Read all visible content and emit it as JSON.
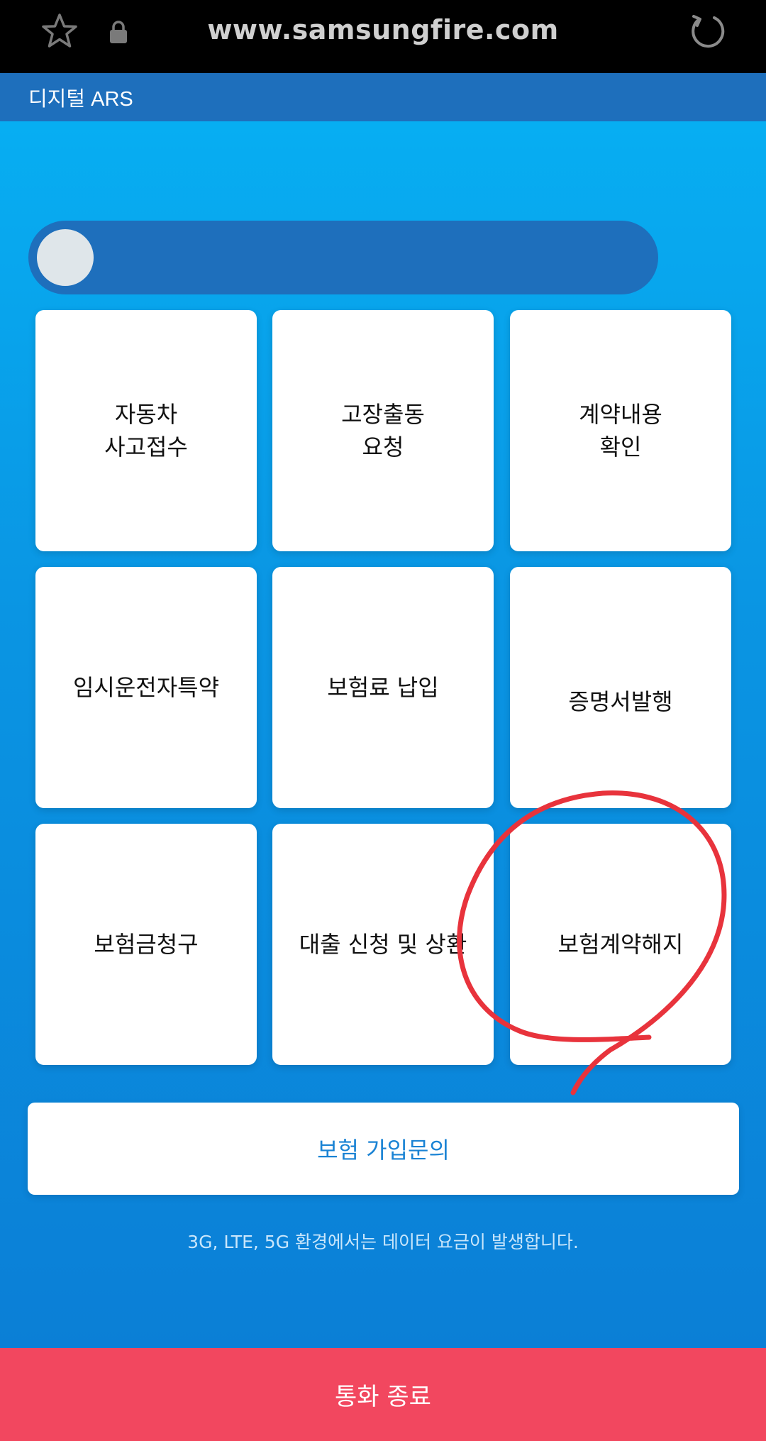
{
  "browser": {
    "url": "www.samsungfire.com",
    "icons": [
      "star-icon",
      "lock-icon",
      "reload-icon"
    ]
  },
  "header": {
    "title": "디지털 ARS"
  },
  "progress": {
    "value": 0
  },
  "menu": [
    {
      "label": "자동차\n사고접수"
    },
    {
      "label": "고장출동\n요청"
    },
    {
      "label": "계약내용\n확인"
    },
    {
      "label": "임시운전자특약"
    },
    {
      "label": "보험료 납입"
    },
    {
      "label": "증명서발행"
    },
    {
      "label": "보험금청구"
    },
    {
      "label": "대출 신청 및 상환"
    },
    {
      "label": "보험계약해지"
    }
  ],
  "inquiry_button": {
    "label": "보험 가입문의"
  },
  "notice": "3G, LTE, 5G 환경에서는 데이터 요금이 발생합니다.",
  "end_call": {
    "label": "통화 종료"
  },
  "colors": {
    "header": "#1e6fbc",
    "background_top": "#07aef2",
    "background_bottom": "#0b7fd6",
    "inquiry_text": "#1a83d4",
    "end_call": "#f2475f",
    "annotation": "#e8333c"
  }
}
